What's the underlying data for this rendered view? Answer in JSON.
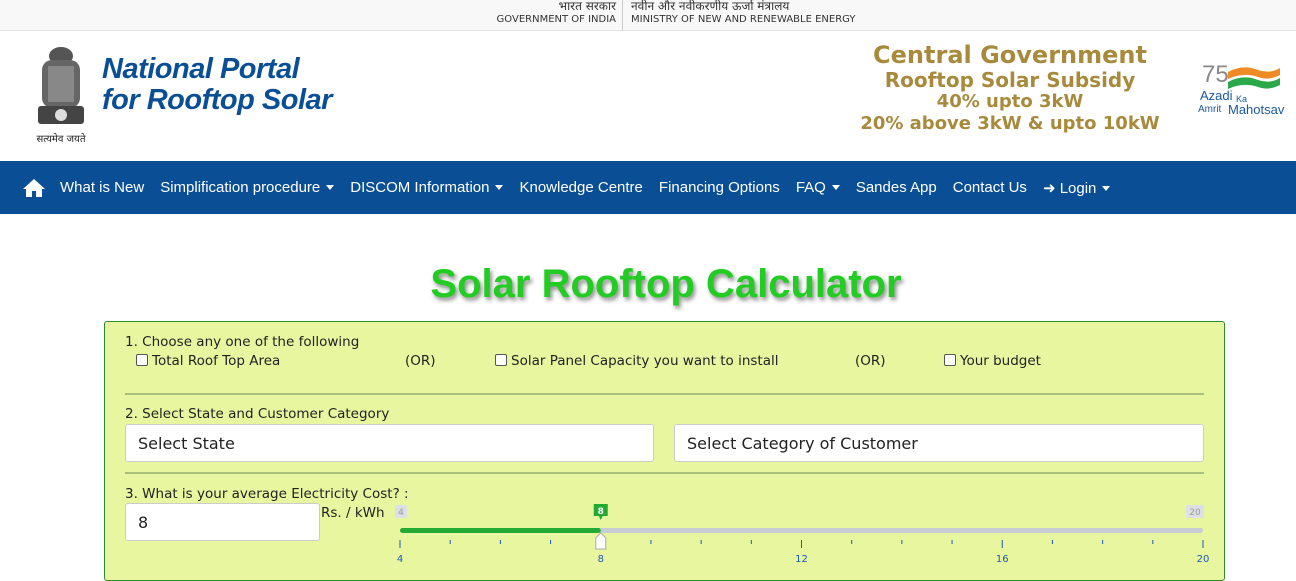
{
  "topbar": {
    "gov_hindi": "भारत सरकार",
    "gov_english": "GOVERNMENT OF INDIA",
    "ministry_hindi": "नवीन और नवीकरणीय ऊर्जा मंत्रालय",
    "ministry_english": "MINISTRY OF NEW AND RENEWABLE ENERGY"
  },
  "header": {
    "emblem_motto": "सत्यमेव जयते",
    "logo_line1": "National Portal",
    "logo_line2": "for Rooftop Solar",
    "subsidy": [
      "Central Government",
      "Rooftop Solar Subsidy",
      "40% upto 3kW",
      "20% above 3kW & upto 10kW"
    ],
    "azadi_logo": "75 Azadi Ka Amrit Mahotsav"
  },
  "nav": {
    "items": [
      {
        "label": "What is New",
        "dropdown": false
      },
      {
        "label": "Simplification procedure",
        "dropdown": true
      },
      {
        "label": "DISCOM Information",
        "dropdown": true
      },
      {
        "label": "Knowledge Centre",
        "dropdown": false
      },
      {
        "label": "Financing Options",
        "dropdown": false
      },
      {
        "label": "FAQ",
        "dropdown": true
      },
      {
        "label": "Sandes App",
        "dropdown": false
      },
      {
        "label": "Contact Us",
        "dropdown": false
      },
      {
        "label": "Login",
        "dropdown": true
      }
    ]
  },
  "page": {
    "title": "Solar Rooftop Calculator"
  },
  "step1": {
    "label": "1. Choose any one of the following",
    "opt1": "Total Roof Top Area",
    "or1": "(OR)",
    "opt2": "Solar Panel Capacity you want to install",
    "or2": "(OR)",
    "opt3": "Your budget"
  },
  "step2": {
    "label": "2. Select State and Customer Category",
    "state_placeholder": "Select State",
    "category_placeholder": "Select Category of Customer"
  },
  "step3": {
    "label": "3. What is your average Electricity Cost? :",
    "value": "8",
    "unit": "Rs. / kWh",
    "slider": {
      "min": 4,
      "max": 20,
      "value": 8,
      "min_label": "4",
      "max_label": "20",
      "value_label": "8",
      "tick_labels": [
        "4",
        "8",
        "12",
        "16",
        "20"
      ]
    }
  },
  "colors": {
    "nav": "#0a4f96",
    "title": "#22cc22",
    "card": "#e9f6a0",
    "slider_fill": "#22aa33"
  }
}
